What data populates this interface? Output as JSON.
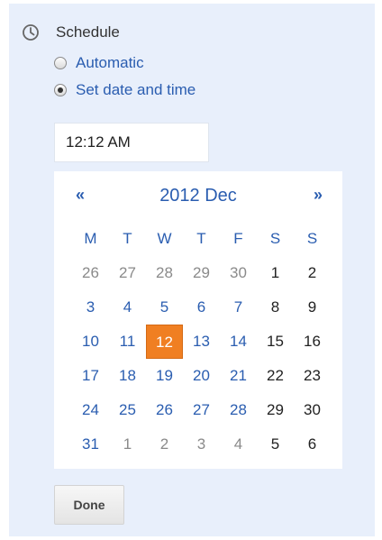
{
  "schedule": {
    "label": "Schedule",
    "icon": "clock-icon",
    "options": [
      {
        "label": "Automatic",
        "checked": false
      },
      {
        "label": "Set date and time",
        "checked": true
      }
    ]
  },
  "time": {
    "value": "12:12 AM"
  },
  "calendar": {
    "prev_label": "«",
    "next_label": "»",
    "title": "2012 Dec",
    "weekdays": [
      "M",
      "T",
      "W",
      "T",
      "F",
      "S",
      "S"
    ],
    "weeks": [
      [
        {
          "d": "26",
          "m": "other"
        },
        {
          "d": "27",
          "m": "other"
        },
        {
          "d": "28",
          "m": "other"
        },
        {
          "d": "29",
          "m": "other"
        },
        {
          "d": "30",
          "m": "other"
        },
        {
          "d": "1",
          "m": "wkend"
        },
        {
          "d": "2",
          "m": "wkend"
        }
      ],
      [
        {
          "d": "3",
          "m": "wkday"
        },
        {
          "d": "4",
          "m": "wkday"
        },
        {
          "d": "5",
          "m": "wkday"
        },
        {
          "d": "6",
          "m": "wkday"
        },
        {
          "d": "7",
          "m": "wkday"
        },
        {
          "d": "8",
          "m": "wkend"
        },
        {
          "d": "9",
          "m": "wkend"
        }
      ],
      [
        {
          "d": "10",
          "m": "wkday"
        },
        {
          "d": "11",
          "m": "wkday"
        },
        {
          "d": "12",
          "m": "sel"
        },
        {
          "d": "13",
          "m": "wkday"
        },
        {
          "d": "14",
          "m": "wkday"
        },
        {
          "d": "15",
          "m": "wkend"
        },
        {
          "d": "16",
          "m": "wkend"
        }
      ],
      [
        {
          "d": "17",
          "m": "wkday"
        },
        {
          "d": "18",
          "m": "wkday"
        },
        {
          "d": "19",
          "m": "wkday"
        },
        {
          "d": "20",
          "m": "wkday"
        },
        {
          "d": "21",
          "m": "wkday"
        },
        {
          "d": "22",
          "m": "wkend"
        },
        {
          "d": "23",
          "m": "wkend"
        }
      ],
      [
        {
          "d": "24",
          "m": "wkday"
        },
        {
          "d": "25",
          "m": "wkday"
        },
        {
          "d": "26",
          "m": "wkday"
        },
        {
          "d": "27",
          "m": "wkday"
        },
        {
          "d": "28",
          "m": "wkday"
        },
        {
          "d": "29",
          "m": "wkend"
        },
        {
          "d": "30",
          "m": "wkend"
        }
      ],
      [
        {
          "d": "31",
          "m": "wkday"
        },
        {
          "d": "1",
          "m": "other"
        },
        {
          "d": "2",
          "m": "other"
        },
        {
          "d": "3",
          "m": "other"
        },
        {
          "d": "4",
          "m": "other"
        },
        {
          "d": "5",
          "m": "wkend"
        },
        {
          "d": "6",
          "m": "wkend"
        }
      ]
    ],
    "selected_day": "12"
  },
  "done_label": "Done",
  "colors": {
    "panel_bg": "#e8effb",
    "link_blue": "#2a5db0",
    "selected_orange": "#f07f22",
    "muted_gray": "#8a8a8a"
  }
}
